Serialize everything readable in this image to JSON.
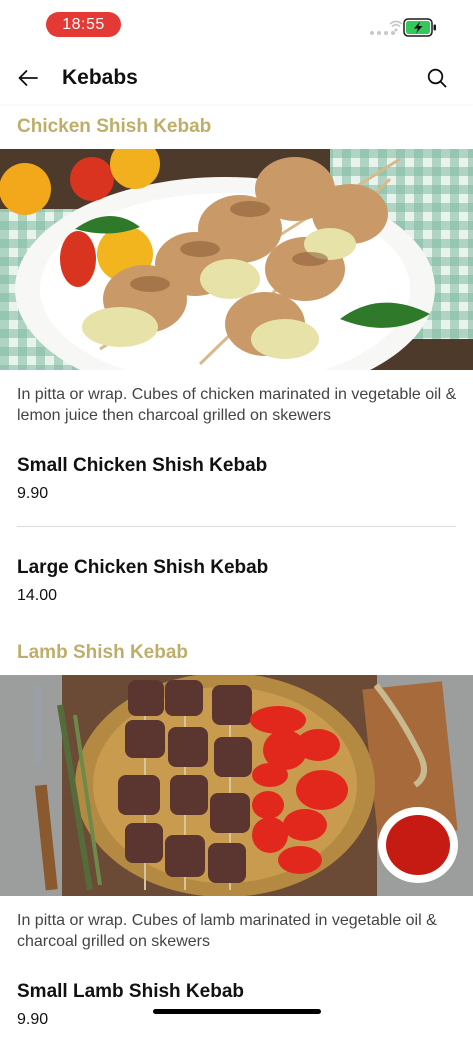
{
  "status_bar": {
    "time": "18:55"
  },
  "header": {
    "title": "Kebabs"
  },
  "sections": [
    {
      "title": "Chicken Shish Kebab",
      "description": "In pitta or wrap. Cubes of chicken marinated in vegetable oil & lemon juice then charcoal grilled on skewers",
      "items": [
        {
          "name": "Small Chicken Shish Kebab",
          "price": "9.90"
        },
        {
          "name": "Large Chicken Shish Kebab",
          "price": "14.00"
        }
      ]
    },
    {
      "title": "Lamb Shish Kebab",
      "description": "In pitta or wrap. Cubes of lamb marinated in vegetable oil & charcoal grilled on skewers",
      "items": [
        {
          "name": "Small Lamb Shish Kebab",
          "price": "9.90"
        }
      ]
    }
  ],
  "colors": {
    "accent": "#bfae6a",
    "time_pill": "#e53935",
    "battery": "#34c759"
  },
  "icons": {
    "back": "arrow-left-icon",
    "search": "search-icon",
    "wifi": "wifi-icon",
    "battery": "battery-charging-icon"
  }
}
